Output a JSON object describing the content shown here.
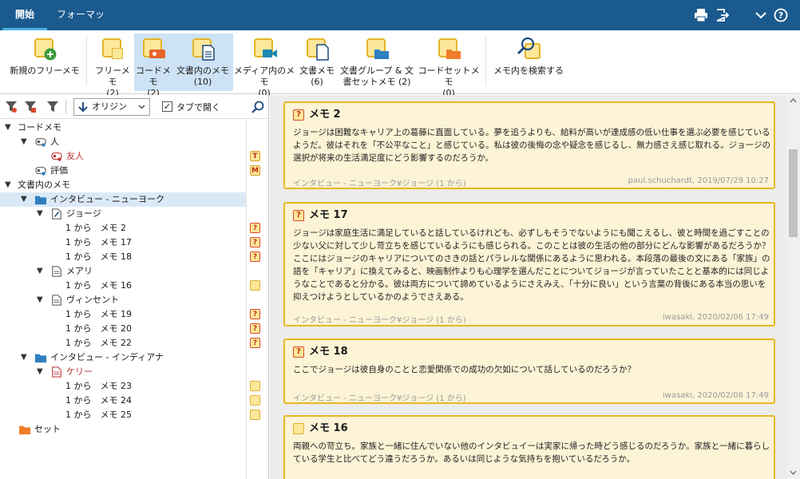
{
  "tabs": {
    "home": "開始",
    "format": "フォーマット"
  },
  "ribbon": {
    "new_free_memo": "新規のフリーメモ",
    "free_memo": "フリーメモ",
    "free_memo_count": "(2)",
    "code_memo": "コードメモ",
    "code_memo_count": "(2)",
    "doc_memo": "文書内のメモ",
    "doc_memo_count": "(10)",
    "media_memo": "メディア内のメモ",
    "media_memo_count": "(0)",
    "document_memo": "文書メモ",
    "document_memo_count": "(6)",
    "docgroup_memo_1": "文書グループ & 文",
    "docgroup_memo_2": "書セットメモ (2)",
    "codeset_memo": "コードセットメモ",
    "codeset_memo_count": "(0)",
    "search_memos": "メモ内を検索する"
  },
  "left_toolbar": {
    "origin": "オリジン",
    "open_in_tab": "タブで開く"
  },
  "tree": {
    "code_memos": "コードメモ",
    "person": "人",
    "friend": "友人",
    "evaluation": "評価",
    "doc_memos": "文書内のメモ",
    "interview_ny": "インタビュー - ニューヨーク",
    "george": "ジョージ",
    "g_memo2": "1 から　メモ 2",
    "g_memo17": "1 から　メモ 17",
    "g_memo18": "1 から　メモ 18",
    "mary": "メアリ",
    "m_memo16": "1 から　メモ 16",
    "vincent": "ヴィンセント",
    "v_memo19": "1 から　メモ 19",
    "v_memo20": "1 から　メモ 20",
    "v_memo22": "1 から　メモ 22",
    "interview_in": "インタビュー - インディアナ",
    "kelly": "ケリー",
    "k_memo23": "1 から　メモ 23",
    "k_memo24": "1 から　メモ 24",
    "k_memo25": "1 から　メモ 25",
    "set": "セット",
    "badge_t": "T",
    "badge_m": "M",
    "badge_q": "?"
  },
  "cards": [
    {
      "title": "メモ 2",
      "body": "ジョージは困難なキャリア上の葛藤に直面している。夢を追うよりも、給料が高いが達成感の低い仕事を選ぶ必要を感じているようだ。彼はそれを「不公平なこと」と感じている。私は彼の後悔の念や疑念を感じるし、無力感さえ感じ取れる。ジョージの選択が将来の生活満足度にどう影響するのだろうか。",
      "source": "インタビュー - ニューヨーク¥ジョージ (1 から)",
      "meta": "paul.schuchardt, 2019/07/29 10:27"
    },
    {
      "title": "メモ 17",
      "body": "ジョージは家庭生活に満足していると話しているけれども、必ずしもそうでないようにも聞こえるし、彼と時間を過ごすことの少ない父に対して少し苛立ちを感じているようにも感じられる。このことは彼の生活の他の部分にどんな影響があるだろうか？\nここにはジョージのキャリアについてのさきの話とパラレルな関係にあるように思われる。本段落の最後の文にある「家族」の語を「キャリア」に換えてみると、映画制作よりも心理学を選んだことについてジョージが言っていたことと基本的には同じようなことであると分かる。彼は両方について諦めているようにさえみえ、「十分に良い」という言葉の背後にある本当の思いを抑えつけようとしているかのようでさえある。",
      "source": "インタビュー - ニューヨーク¥ジョージ (1 から)",
      "meta": "iwasaki, 2020/02/06 17:49"
    },
    {
      "title": "メモ 18",
      "body": "ここでジョージは彼自身のことと恋愛関係での成功の欠如について話しているのだろうか？",
      "source": "インタビュー - ニューヨーク¥ジョージ (1 から)",
      "meta": "iwasaki, 2020/02/06 17:49"
    },
    {
      "title": "メモ 16",
      "body": "両親への苛立ち。家族と一緒に住んでいない他のインタビュイーは実家に帰った時どう感じるのだろうか。家族と一緒に暮らしている学生と比べてどう違うだろうか。あるいは同じような気持ちを抱いているだろうか。",
      "source": "",
      "meta": ""
    }
  ],
  "colors": {
    "titlebar": "#1b5a8e",
    "memo_fill": "#fde79a",
    "memo_border": "#e8b820",
    "card_bg": "#fdf3d6",
    "selection": "#cde3f5"
  },
  "icons": [
    "printer-icon",
    "export-icon",
    "chevron-down-icon",
    "help-icon",
    "search-icon",
    "filter-icon",
    "folder-icon",
    "document-icon",
    "code-icon"
  ]
}
